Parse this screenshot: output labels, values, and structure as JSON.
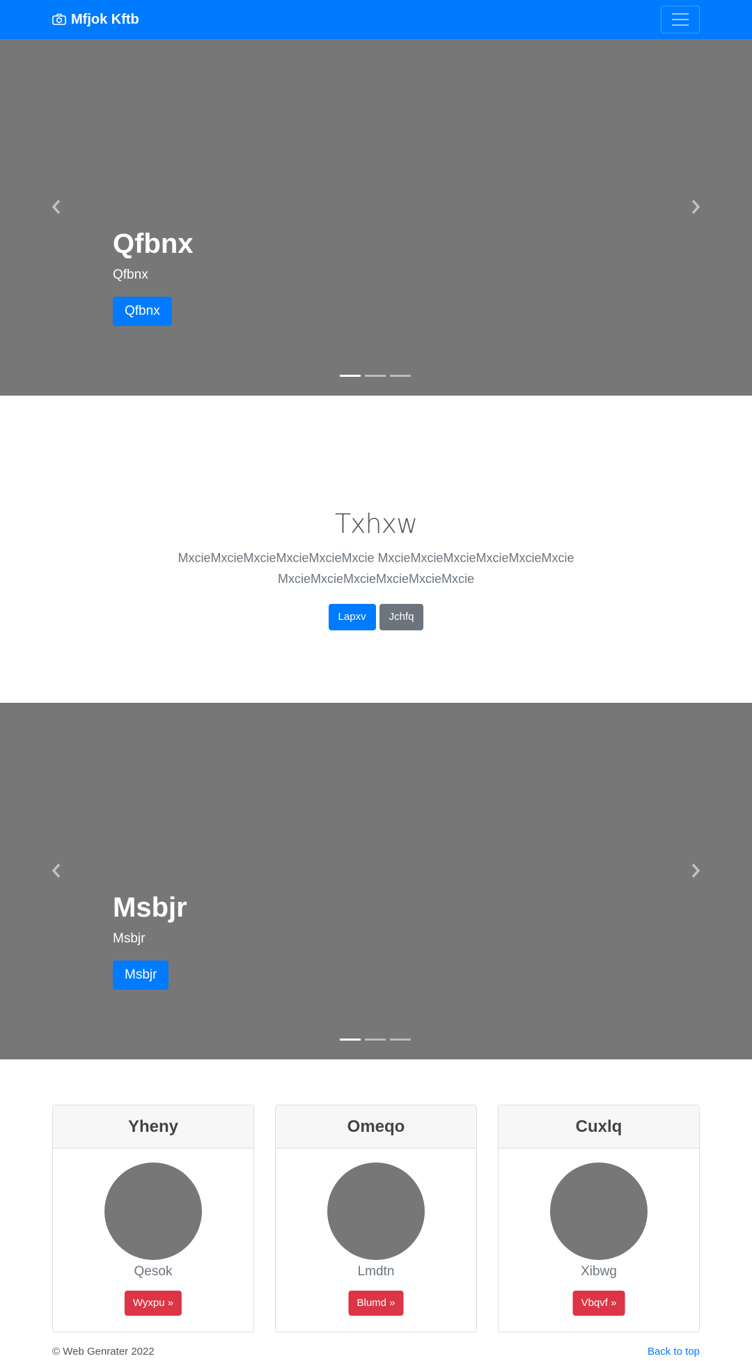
{
  "navbar": {
    "brand": "Mfjok Kftb",
    "brand_icon": "camera-icon",
    "toggler_icon": "hamburger-icon",
    "color": "#007bff"
  },
  "carousel_1": {
    "title": "Qfbnx",
    "subtitle": "Qfbnx",
    "button": "Qfbnx",
    "prev_icon": "chevron-left-icon",
    "next_icon": "chevron-right-icon",
    "slides": 3,
    "active_slide": 1
  },
  "jumbotron": {
    "heading": "Txhxw",
    "lead": "MxcieMxcieMxcieMxcieMxcieMxcie MxcieMxcieMxcieMxcieMxcieMxcie MxcieMxcieMxcieMxcieMxcieMxcie",
    "primary_button": "Lapxv",
    "secondary_button": "Jchfq"
  },
  "carousel_2": {
    "title": "Msbjr",
    "subtitle": "Msbjr",
    "button": "Msbjr",
    "prev_icon": "chevron-left-icon",
    "next_icon": "chevron-right-icon",
    "slides": 3,
    "active_slide": 1
  },
  "cards": [
    {
      "header": "Yheny",
      "subtitle": "Qesok",
      "button": "Wyxpu »"
    },
    {
      "header": "Omeqo",
      "subtitle": "Lmdtn",
      "button": "Blumd »"
    },
    {
      "header": "Cuxlq",
      "subtitle": "Xibwg",
      "button": "Vbqvf »"
    }
  ],
  "footer": {
    "copyright": "© Web Genrater 2022",
    "back_to_top": "Back to top"
  },
  "colors": {
    "primary": "#007bff",
    "secondary": "#6c757d",
    "danger": "#dc3545",
    "placeholder": "#777777"
  }
}
